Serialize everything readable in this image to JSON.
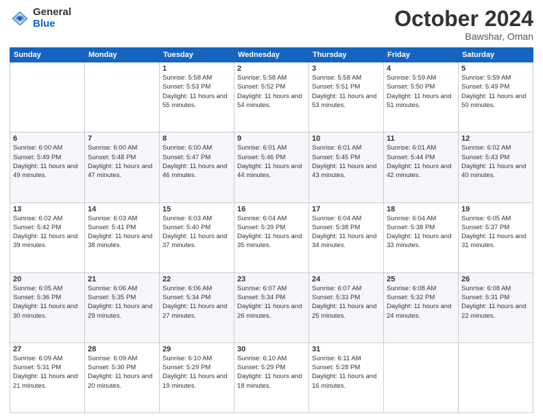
{
  "logo": {
    "general": "General",
    "blue": "Blue"
  },
  "title": {
    "month_year": "October 2024",
    "location": "Bawshar, Oman"
  },
  "weekdays": [
    "Sunday",
    "Monday",
    "Tuesday",
    "Wednesday",
    "Thursday",
    "Friday",
    "Saturday"
  ],
  "weeks": [
    [
      {
        "day": "",
        "sunrise": "",
        "sunset": "",
        "daylight": ""
      },
      {
        "day": "",
        "sunrise": "",
        "sunset": "",
        "daylight": ""
      },
      {
        "day": "1",
        "sunrise": "Sunrise: 5:58 AM",
        "sunset": "Sunset: 5:53 PM",
        "daylight": "Daylight: 11 hours and 55 minutes."
      },
      {
        "day": "2",
        "sunrise": "Sunrise: 5:58 AM",
        "sunset": "Sunset: 5:52 PM",
        "daylight": "Daylight: 11 hours and 54 minutes."
      },
      {
        "day": "3",
        "sunrise": "Sunrise: 5:58 AM",
        "sunset": "Sunset: 5:51 PM",
        "daylight": "Daylight: 11 hours and 53 minutes."
      },
      {
        "day": "4",
        "sunrise": "Sunrise: 5:59 AM",
        "sunset": "Sunset: 5:50 PM",
        "daylight": "Daylight: 11 hours and 51 minutes."
      },
      {
        "day": "5",
        "sunrise": "Sunrise: 5:59 AM",
        "sunset": "Sunset: 5:49 PM",
        "daylight": "Daylight: 11 hours and 50 minutes."
      }
    ],
    [
      {
        "day": "6",
        "sunrise": "Sunrise: 6:00 AM",
        "sunset": "Sunset: 5:49 PM",
        "daylight": "Daylight: 11 hours and 49 minutes."
      },
      {
        "day": "7",
        "sunrise": "Sunrise: 6:00 AM",
        "sunset": "Sunset: 5:48 PM",
        "daylight": "Daylight: 11 hours and 47 minutes."
      },
      {
        "day": "8",
        "sunrise": "Sunrise: 6:00 AM",
        "sunset": "Sunset: 5:47 PM",
        "daylight": "Daylight: 11 hours and 46 minutes."
      },
      {
        "day": "9",
        "sunrise": "Sunrise: 6:01 AM",
        "sunset": "Sunset: 5:46 PM",
        "daylight": "Daylight: 11 hours and 44 minutes."
      },
      {
        "day": "10",
        "sunrise": "Sunrise: 6:01 AM",
        "sunset": "Sunset: 5:45 PM",
        "daylight": "Daylight: 11 hours and 43 minutes."
      },
      {
        "day": "11",
        "sunrise": "Sunrise: 6:01 AM",
        "sunset": "Sunset: 5:44 PM",
        "daylight": "Daylight: 11 hours and 42 minutes."
      },
      {
        "day": "12",
        "sunrise": "Sunrise: 6:02 AM",
        "sunset": "Sunset: 5:43 PM",
        "daylight": "Daylight: 11 hours and 40 minutes."
      }
    ],
    [
      {
        "day": "13",
        "sunrise": "Sunrise: 6:02 AM",
        "sunset": "Sunset: 5:42 PM",
        "daylight": "Daylight: 11 hours and 39 minutes."
      },
      {
        "day": "14",
        "sunrise": "Sunrise: 6:03 AM",
        "sunset": "Sunset: 5:41 PM",
        "daylight": "Daylight: 11 hours and 38 minutes."
      },
      {
        "day": "15",
        "sunrise": "Sunrise: 6:03 AM",
        "sunset": "Sunset: 5:40 PM",
        "daylight": "Daylight: 11 hours and 37 minutes."
      },
      {
        "day": "16",
        "sunrise": "Sunrise: 6:04 AM",
        "sunset": "Sunset: 5:39 PM",
        "daylight": "Daylight: 11 hours and 35 minutes."
      },
      {
        "day": "17",
        "sunrise": "Sunrise: 6:04 AM",
        "sunset": "Sunset: 5:38 PM",
        "daylight": "Daylight: 11 hours and 34 minutes."
      },
      {
        "day": "18",
        "sunrise": "Sunrise: 6:04 AM",
        "sunset": "Sunset: 5:38 PM",
        "daylight": "Daylight: 11 hours and 33 minutes."
      },
      {
        "day": "19",
        "sunrise": "Sunrise: 6:05 AM",
        "sunset": "Sunset: 5:37 PM",
        "daylight": "Daylight: 11 hours and 31 minutes."
      }
    ],
    [
      {
        "day": "20",
        "sunrise": "Sunrise: 6:05 AM",
        "sunset": "Sunset: 5:36 PM",
        "daylight": "Daylight: 11 hours and 30 minutes."
      },
      {
        "day": "21",
        "sunrise": "Sunrise: 6:06 AM",
        "sunset": "Sunset: 5:35 PM",
        "daylight": "Daylight: 11 hours and 29 minutes."
      },
      {
        "day": "22",
        "sunrise": "Sunrise: 6:06 AM",
        "sunset": "Sunset: 5:34 PM",
        "daylight": "Daylight: 11 hours and 27 minutes."
      },
      {
        "day": "23",
        "sunrise": "Sunrise: 6:07 AM",
        "sunset": "Sunset: 5:34 PM",
        "daylight": "Daylight: 11 hours and 26 minutes."
      },
      {
        "day": "24",
        "sunrise": "Sunrise: 6:07 AM",
        "sunset": "Sunset: 5:33 PM",
        "daylight": "Daylight: 11 hours and 25 minutes."
      },
      {
        "day": "25",
        "sunrise": "Sunrise: 6:08 AM",
        "sunset": "Sunset: 5:32 PM",
        "daylight": "Daylight: 11 hours and 24 minutes."
      },
      {
        "day": "26",
        "sunrise": "Sunrise: 6:08 AM",
        "sunset": "Sunset: 5:31 PM",
        "daylight": "Daylight: 11 hours and 22 minutes."
      }
    ],
    [
      {
        "day": "27",
        "sunrise": "Sunrise: 6:09 AM",
        "sunset": "Sunset: 5:31 PM",
        "daylight": "Daylight: 11 hours and 21 minutes."
      },
      {
        "day": "28",
        "sunrise": "Sunrise: 6:09 AM",
        "sunset": "Sunset: 5:30 PM",
        "daylight": "Daylight: 11 hours and 20 minutes."
      },
      {
        "day": "29",
        "sunrise": "Sunrise: 6:10 AM",
        "sunset": "Sunset: 5:29 PM",
        "daylight": "Daylight: 11 hours and 19 minutes."
      },
      {
        "day": "30",
        "sunrise": "Sunrise: 6:10 AM",
        "sunset": "Sunset: 5:29 PM",
        "daylight": "Daylight: 11 hours and 18 minutes."
      },
      {
        "day": "31",
        "sunrise": "Sunrise: 6:11 AM",
        "sunset": "Sunset: 5:28 PM",
        "daylight": "Daylight: 11 hours and 16 minutes."
      },
      {
        "day": "",
        "sunrise": "",
        "sunset": "",
        "daylight": ""
      },
      {
        "day": "",
        "sunrise": "",
        "sunset": "",
        "daylight": ""
      }
    ]
  ]
}
